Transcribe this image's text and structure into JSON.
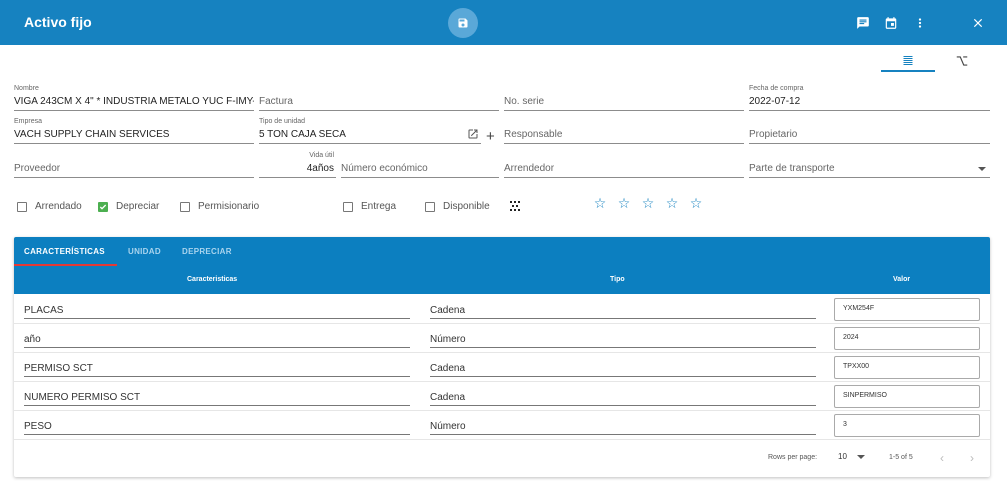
{
  "header": {
    "title": "Activo fijo"
  },
  "fields": {
    "nombre": {
      "label": "Nombre",
      "value": "VIGA 243CM X 4\" * INDUSTRIA METALO YUC F-IMY-0"
    },
    "factura": {
      "placeholder": "Factura"
    },
    "no_serie": {
      "placeholder": "No. serie"
    },
    "fecha_compra": {
      "label": "Fecha de compra",
      "value": "2022-07-12"
    },
    "empresa": {
      "label": "Empresa",
      "value": "VACH SUPPLY CHAIN SERVICES"
    },
    "tipo_unidad": {
      "label": "Tipo de unidad",
      "value": "5 TON CAJA SECA"
    },
    "responsable": {
      "placeholder": "Responsable"
    },
    "propietario": {
      "placeholder": "Propietario"
    },
    "proveedor": {
      "placeholder": "Proveedor"
    },
    "vida_util": {
      "label": "Vida útil",
      "value": "4años"
    },
    "numero_economico": {
      "placeholder": "Número económico"
    },
    "arrendedor": {
      "placeholder": "Arrendedor"
    },
    "parte_transporte": {
      "placeholder": "Parte de transporte"
    }
  },
  "checkboxes": [
    {
      "label": "Arrendado",
      "checked": false
    },
    {
      "label": "Depreciar",
      "checked": true
    },
    {
      "label": "Permisionario",
      "checked": false
    },
    {
      "label": "Entrega",
      "checked": false
    },
    {
      "label": "Disponible",
      "checked": false
    }
  ],
  "rating": {
    "value": 0,
    "max": 5
  },
  "tabs": [
    "CARACTERÍSTICAS",
    "UNIDAD",
    "DEPRECIAR"
  ],
  "table": {
    "headers": [
      "Caracteristicas",
      "Tipo",
      "Valor"
    ],
    "rows": [
      {
        "caracteristica": "PLACAS",
        "tipo": "Cadena",
        "valor": "YXM254F"
      },
      {
        "caracteristica": "año",
        "tipo": "Número",
        "valor": "2024"
      },
      {
        "caracteristica": "PERMISO SCT",
        "tipo": "Cadena",
        "valor": "TPXX00"
      },
      {
        "caracteristica": "NUMERO PERMISO SCT",
        "tipo": "Cadena",
        "valor": "SINPERMISO"
      },
      {
        "caracteristica": "PESO",
        "tipo": "Número",
        "valor": "3"
      }
    ]
  },
  "pagination": {
    "rows_per_page_label": "Rows per page:",
    "rows_per_page": "10",
    "range": "1-5 of 5"
  },
  "colors": {
    "primary": "#1682c0",
    "tab_indicator": "#e53935",
    "check": "#4caf50"
  }
}
